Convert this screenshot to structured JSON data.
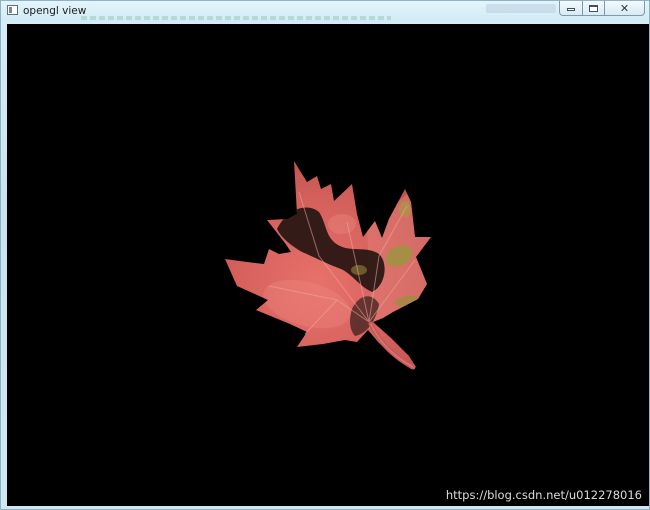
{
  "window": {
    "title": "opengl view",
    "app_icon": "window-app-icon",
    "controls": {
      "minimize_icon": "minimize-icon",
      "maximize_icon": "maximize-icon",
      "close_icon": "close-icon",
      "close_glyph": "✕"
    }
  },
  "viewport": {
    "background": "#000000",
    "content": "maple-leaf-texture",
    "leaf_colors": {
      "body": "#d9615d",
      "highlight": "#ee8a82",
      "shadow": "#2b1815",
      "yellow_patch": "#a39a3e",
      "vein": "#f3a9a2",
      "stem": "#c65a5a"
    }
  },
  "watermark": {
    "text": "https://blog.csdn.net/u012278016"
  }
}
